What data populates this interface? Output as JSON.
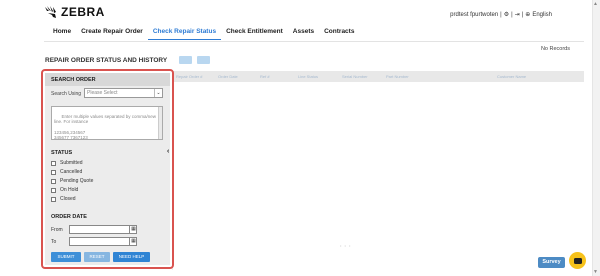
{
  "brand": {
    "name": "ZEBRA",
    "logo_icon": "zebra-head-icon"
  },
  "user_bar": {
    "user": "prdtest fpurtwoten",
    "separator": "|",
    "logout_icon": "logout-icon",
    "settings_icon": "gear-icon",
    "language": "English",
    "globe_icon": "globe-icon"
  },
  "nav": {
    "items": [
      {
        "label": "Home",
        "active": false
      },
      {
        "label": "Create Repair Order",
        "active": false
      },
      {
        "label": "Check Repair Status",
        "active": true
      },
      {
        "label": "Check Entitlement",
        "active": false
      },
      {
        "label": "Assets",
        "active": false
      },
      {
        "label": "Contracts",
        "active": false
      }
    ]
  },
  "main": {
    "title": "REPAIR ORDER STATUS AND HISTORY",
    "no_records": "No Records",
    "columns": [
      "Repair Order #",
      "Order Date",
      "Ref #",
      "Line Status",
      "Serial Number",
      "Part Number",
      "Customer Name"
    ]
  },
  "search_panel": {
    "title": "SEARCH ORDER",
    "search_using_label": "Search Using",
    "search_using_value": "Please Select",
    "textarea_placeholder": "Enter multiple values separated by comma/new line. For instance\n\n123456,234567\n345677 7367123",
    "status_title": "STATUS",
    "statuses": [
      "Submitted",
      "Cancelled",
      "Pending Quote",
      "On Hold",
      "Closed"
    ],
    "order_date_title": "ORDER DATE",
    "from_label": "From",
    "to_label": "To",
    "buttons": {
      "submit": "SUBMIT",
      "reset": "RESET",
      "help": "NEED HELP"
    }
  },
  "survey": {
    "label": "Survey"
  },
  "colors": {
    "accent": "#2d7bd4",
    "highlight_border": "#d9534f",
    "chat": "#f7c21b"
  }
}
